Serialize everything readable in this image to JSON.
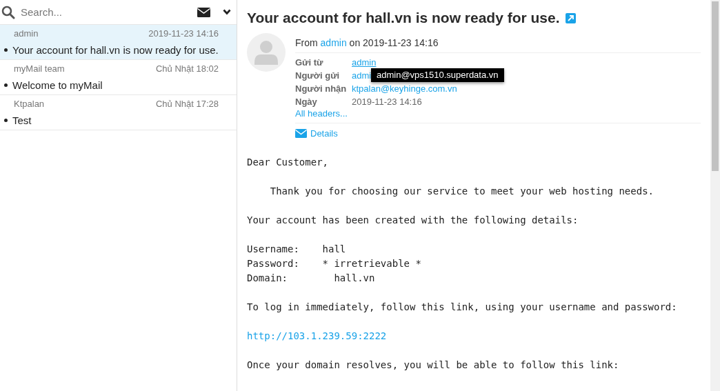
{
  "search": {
    "placeholder": "Search..."
  },
  "messages": [
    {
      "sender": "admin",
      "date": "2019-11-23 14:16",
      "subject": "Your account for hall.vn is now ready for use.",
      "selected": true,
      "unread": true
    },
    {
      "sender": "myMail team",
      "date": "Chủ Nhật 18:02",
      "subject": "Welcome to myMail",
      "selected": false,
      "unread": true
    },
    {
      "sender": "Ktpalan",
      "date": "Chủ Nhật 17:28",
      "subject": "Test",
      "selected": false,
      "unread": true
    }
  ],
  "message": {
    "title": "Your account for hall.vn is now ready for use.",
    "from_prefix": "From",
    "from_name": "admin",
    "from_on": "on 2019-11-23 14:16",
    "headers": [
      {
        "label": "Gửi từ",
        "value": "admin",
        "kind": "link"
      },
      {
        "label": "Người gửi",
        "value": "admi",
        "kind": "link"
      },
      {
        "label": "Người nhận",
        "value": "ktpalan@keyhinge.com.vn",
        "kind": "link"
      },
      {
        "label": "Ngày",
        "value": "2019-11-23 14:16",
        "kind": "text"
      }
    ],
    "all_headers": "All headers...",
    "details": "Details",
    "tooltip": "admin@vps1510.superdata.vn",
    "body": [
      {
        "kind": "text",
        "text": "Dear Customer,"
      },
      {
        "kind": "text",
        "text": "    Thank you for choosing our service to meet your web hosting needs."
      },
      {
        "kind": "text",
        "text": "Your account has been created with the following details:"
      },
      {
        "kind": "text",
        "text": "Username:    hall\nPassword:    * irretrievable *\nDomain:        hall.vn"
      },
      {
        "kind": "text",
        "text": "To log in immediately, follow this link, using your username and password:"
      },
      {
        "kind": "link",
        "text": "http://103.1.239.59:2222"
      },
      {
        "kind": "text",
        "text": "Once your domain resolves, you will be able to follow this link:"
      }
    ]
  }
}
